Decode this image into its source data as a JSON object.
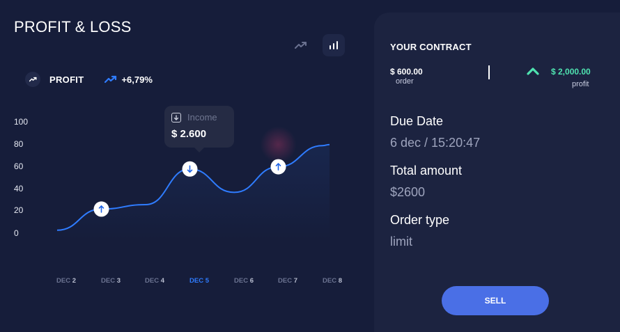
{
  "header": {
    "title": "PROFIT & LOSS"
  },
  "toolbar": {
    "trend_icon": "trending-up-icon",
    "bars_icon": "bar-chart-icon"
  },
  "profit": {
    "label": "PROFIT",
    "percent": "+6,79%"
  },
  "chart": {
    "y_ticks": [
      "100",
      "80",
      "60",
      "40",
      "20",
      "0"
    ],
    "x_ticks": [
      {
        "prefix": "DEC",
        "num": "2",
        "active": false
      },
      {
        "prefix": "DEC",
        "num": "3",
        "active": false
      },
      {
        "prefix": "DEC",
        "num": "4",
        "active": false
      },
      {
        "prefix": "DEC",
        "num": "5",
        "active": true
      },
      {
        "prefix": "DEC",
        "num": "6",
        "active": false
      },
      {
        "prefix": "DEC",
        "num": "7",
        "active": false
      },
      {
        "prefix": "DEC",
        "num": "8",
        "active": false
      }
    ],
    "tooltip": {
      "label": "Income",
      "value": "$ 2.600"
    },
    "line_color": "#2f7cff",
    "accent_green": "#4fe3b0"
  },
  "chart_data": {
    "type": "line",
    "x": [
      "DEC 2",
      "DEC 3",
      "DEC 4",
      "DEC 5",
      "DEC 6",
      "DEC 7",
      "DEC 8"
    ],
    "values": [
      2,
      21,
      25,
      57,
      36,
      59,
      78
    ],
    "markers": [
      {
        "x": "DEC 3",
        "y": 21,
        "direction": "up"
      },
      {
        "x": "DEC 5",
        "y": 57,
        "direction": "down"
      },
      {
        "x": "DEC 7",
        "y": 59,
        "direction": "up"
      }
    ],
    "ylim": [
      0,
      100
    ],
    "title": "",
    "xlabel": "",
    "ylabel": ""
  },
  "contract": {
    "title": "YOUR CONTRACT",
    "order_amount": "$ 600.00",
    "order_label": "order",
    "profit_amount": "$ 2,000.00",
    "profit_label": "profit",
    "due_date_title": "Due Date",
    "due_date_value": "6 dec / 15:20:47",
    "total_title": "Total amount",
    "total_value": "$2600",
    "type_title": "Order type",
    "type_value": "limit",
    "sell_label": "SELL"
  }
}
